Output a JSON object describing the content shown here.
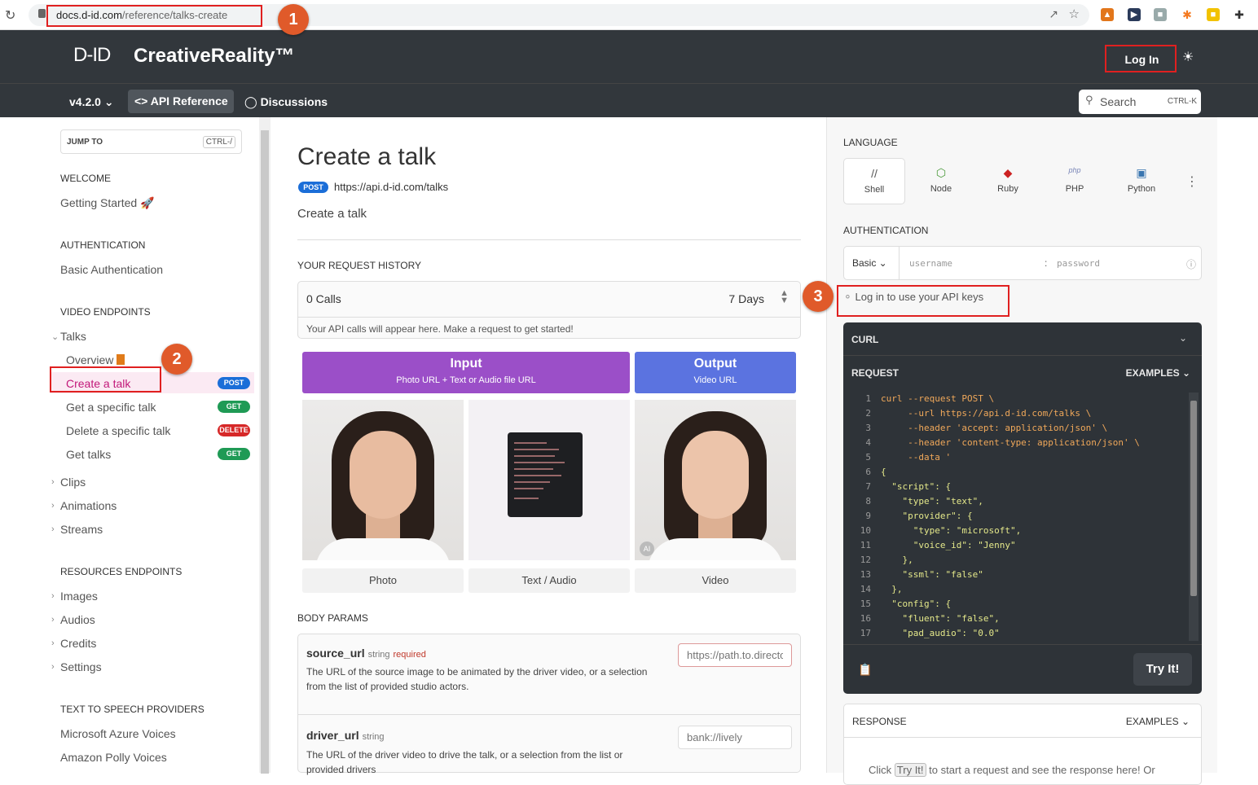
{
  "browser": {
    "url_domain": "docs.d-id.com",
    "url_path": "/reference/talks-create"
  },
  "annotations": [
    "1",
    "2",
    "3"
  ],
  "header": {
    "logo": "D-ID",
    "brand": "CreativeReality™",
    "login": "Log In",
    "version": "v4.2.0",
    "api_reference": "API Reference",
    "discussions": "Discussions",
    "search": "Search",
    "search_key": "CTRL-K"
  },
  "sidebar": {
    "jump_to": "JUMP TO",
    "jump_key": "CTRL-/",
    "welcome": "WELCOME",
    "getting_started": "Getting Started",
    "authentication": "AUTHENTICATION",
    "basic_auth": "Basic Authentication",
    "video_endpoints": "VIDEO ENDPOINTS",
    "talks": "Talks",
    "talk_items": [
      {
        "label": "Overview",
        "method": ""
      },
      {
        "label": "Create a talk",
        "method": "POST"
      },
      {
        "label": "Get a specific talk",
        "method": "GET"
      },
      {
        "label": "Delete a specific talk",
        "method": "DELETE"
      },
      {
        "label": "Get talks",
        "method": "GET"
      }
    ],
    "video_groups": [
      "Clips",
      "Animations",
      "Streams"
    ],
    "resources_endpoints": "RESOURCES ENDPOINTS",
    "resource_groups": [
      "Images",
      "Audios",
      "Credits",
      "Settings"
    ],
    "tts_providers": "TEXT TO SPEECH PROVIDERS",
    "tts_items": [
      "Microsoft Azure Voices",
      "Amazon Polly Voices"
    ]
  },
  "main": {
    "title": "Create a talk",
    "method": "POST",
    "endpoint": "https://api.d-id.com/talks",
    "description": "Create a talk",
    "history_label": "YOUR REQUEST HISTORY",
    "calls": "0 Calls",
    "days": "7 Days",
    "history_note": "Your API calls will appear here. Make a request to get started!",
    "input_title": "Input",
    "input_sub": "Photo URL + Text or Audio file URL",
    "output_title": "Output",
    "output_sub": "Video URL",
    "tile_labels": [
      "Photo",
      "Text / Audio",
      "Video"
    ],
    "ai_badge": "AI",
    "body_params": "BODY PARAMS",
    "params": [
      {
        "name": "source_url",
        "type": "string",
        "required": "required",
        "desc": "The URL of the source image to be animated by the driver video, or a selection from the list of provided studio actors.",
        "placeholder": "https://path.to.directory/"
      },
      {
        "name": "driver_url",
        "type": "string",
        "required": "",
        "desc": "The URL of the driver video to drive the talk, or a selection from the list or provided drivers",
        "placeholder": "bank://lively"
      }
    ]
  },
  "right": {
    "language_label": "LANGUAGE",
    "languages": [
      "Shell",
      "Node",
      "Ruby",
      "PHP",
      "Python"
    ],
    "auth_label": "AUTHENTICATION",
    "auth_type": "Basic",
    "username_ph": "username",
    "password_ph": "password",
    "api_keys": "Log in to use your API keys",
    "curl_label": "CURL",
    "request_label": "REQUEST",
    "examples": "EXAMPLES",
    "code_lines": [
      "curl --request POST \\",
      "     --url https://api.d-id.com/talks \\",
      "     --header 'accept: application/json' \\",
      "     --header 'content-type: application/json' \\",
      "     --data '",
      "{",
      "  \"script\": {",
      "    \"type\": \"text\",",
      "    \"provider\": {",
      "      \"type\": \"microsoft\",",
      "      \"voice_id\": \"Jenny\"",
      "    },",
      "    \"ssml\": \"false\"",
      "  },",
      "  \"config\": {",
      "    \"fluent\": \"false\",",
      "    \"pad_audio\": \"0.0\""
    ],
    "try_it": "Try It!",
    "response_label": "RESPONSE",
    "response_examples": "EXAMPLES",
    "response_msg_pre": "Click",
    "response_msg_btn": "Try It!",
    "response_msg_post": "to start a request and see the response here! Or"
  }
}
